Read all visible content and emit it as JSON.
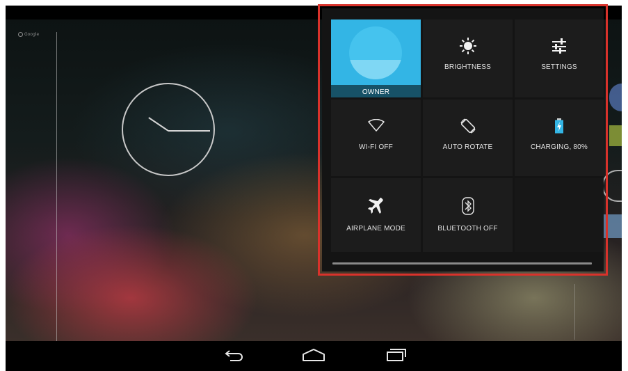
{
  "home": {
    "search_hint": "Google"
  },
  "quick_settings": {
    "tiles": [
      {
        "label": "OWNER",
        "icon": "user-avatar-icon"
      },
      {
        "label": "BRIGHTNESS",
        "icon": "brightness-icon"
      },
      {
        "label": "SETTINGS",
        "icon": "settings-sliders-icon"
      },
      {
        "label": "WI-FI OFF",
        "icon": "wifi-off-icon"
      },
      {
        "label": "AUTO ROTATE",
        "icon": "auto-rotate-icon"
      },
      {
        "label": "CHARGING, 80%",
        "icon": "battery-charging-icon"
      },
      {
        "label": "AIRPLANE MODE",
        "icon": "airplane-icon"
      },
      {
        "label": "BLUETOOTH OFF",
        "icon": "bluetooth-icon"
      }
    ],
    "colors": {
      "owner_tile": "#33b5e5",
      "highlight_border": "#d9322b",
      "battery": "#33b5e5"
    },
    "battery_level": 0.8
  },
  "navigation": {
    "buttons": [
      "back-icon",
      "home-icon",
      "recent-apps-icon"
    ]
  }
}
